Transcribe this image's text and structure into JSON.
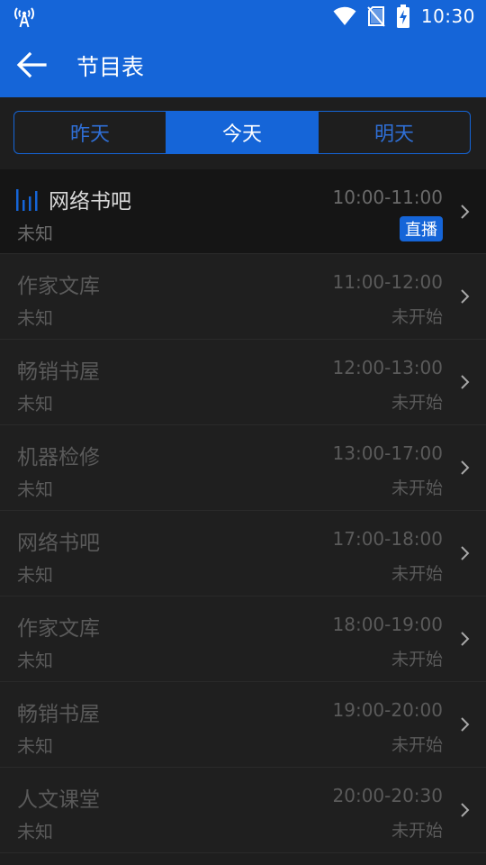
{
  "status_bar": {
    "time": "10:30",
    "left_icon": "broadcast-antenna-icon",
    "right_icons": [
      "wifi-icon",
      "no-sim-icon",
      "battery-charging-icon"
    ]
  },
  "app_bar": {
    "title": "节目表",
    "back_icon": "arrow-left-icon"
  },
  "tabs": [
    {
      "label": "昨天",
      "active": false
    },
    {
      "label": "今天",
      "active": true
    },
    {
      "label": "明天",
      "active": false
    }
  ],
  "programs": [
    {
      "name": "网络书吧",
      "sub": "未知",
      "time": "10:00-11:00",
      "status": "直播",
      "current": true
    },
    {
      "name": "作家文库",
      "sub": "未知",
      "time": "11:00-12:00",
      "status": "未开始",
      "current": false
    },
    {
      "name": "畅销书屋",
      "sub": "未知",
      "time": "12:00-13:00",
      "status": "未开始",
      "current": false
    },
    {
      "name": "机器检修",
      "sub": "未知",
      "time": "13:00-17:00",
      "status": "未开始",
      "current": false
    },
    {
      "name": "网络书吧",
      "sub": "未知",
      "time": "17:00-18:00",
      "status": "未开始",
      "current": false
    },
    {
      "name": "作家文库",
      "sub": "未知",
      "time": "18:00-19:00",
      "status": "未开始",
      "current": false
    },
    {
      "name": "畅销书屋",
      "sub": "未知",
      "time": "19:00-20:00",
      "status": "未开始",
      "current": false
    },
    {
      "name": "人文课堂",
      "sub": "未知",
      "time": "20:00-20:30",
      "status": "未开始",
      "current": false
    }
  ],
  "colors": {
    "primary": "#1565d8",
    "background": "#1e1e1e",
    "current_row": "#151515",
    "muted_text": "#5a5a5a"
  }
}
